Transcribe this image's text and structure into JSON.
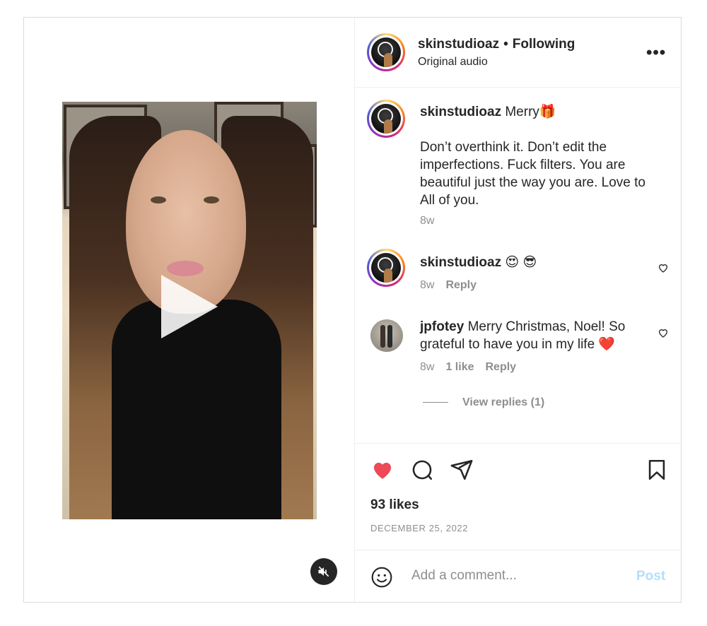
{
  "post": {
    "username": "skinstudioaz",
    "following_label": "Following",
    "separator": "•",
    "audio_label": "Original audio",
    "more_label": "•••"
  },
  "caption": {
    "username": "skinstudioaz",
    "first_line": "Merry🎁",
    "body": "Don’t overthink it. Don’t edit the imperfections. Fuck filters. You are beautiful just the way you are. Love to All of you.",
    "time": "8w"
  },
  "comments": [
    {
      "username": "skinstudioaz",
      "text": "😍 😎",
      "time": "8w",
      "reply_label": "Reply"
    },
    {
      "username": "jpfotey",
      "text": "Merry Christmas, Noel! So grateful to have you in my life ❤️",
      "time": "8w",
      "likes_label": "1 like",
      "reply_label": "Reply"
    }
  ],
  "view_replies": "View replies (1)",
  "likes": "93 likes",
  "date": "DECEMBER 25, 2022",
  "compose": {
    "placeholder": "Add a comment...",
    "post_label": "Post"
  },
  "colors": {
    "like_red": "#ed4956",
    "post_disabled": "#b2dffc",
    "muted_text": "#8e8e8e"
  },
  "icons": [
    "play-icon",
    "mute-icon",
    "more-icon",
    "heart-icon",
    "comment-icon",
    "share-icon",
    "bookmark-icon",
    "emoji-icon"
  ]
}
